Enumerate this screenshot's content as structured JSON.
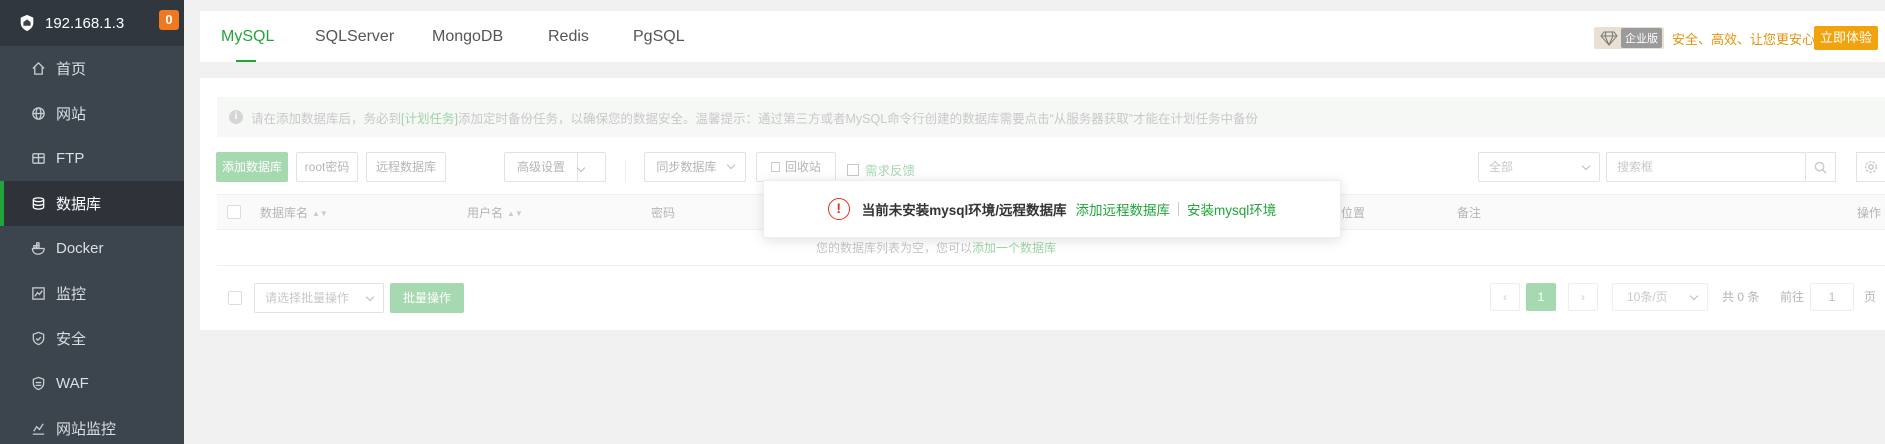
{
  "sidebar": {
    "ip": "192.168.1.3",
    "badge": "0",
    "items": [
      {
        "label": "首页",
        "icon": "home-icon"
      },
      {
        "label": "网站",
        "icon": "globe-icon"
      },
      {
        "label": "FTP",
        "icon": "ftp-icon"
      },
      {
        "label": "数据库",
        "icon": "database-icon"
      },
      {
        "label": "Docker",
        "icon": "docker-icon"
      },
      {
        "label": "监控",
        "icon": "monitor-icon"
      },
      {
        "label": "安全",
        "icon": "shield-icon"
      },
      {
        "label": "WAF",
        "icon": "waf-icon"
      },
      {
        "label": "网站监控",
        "icon": "chart-icon"
      }
    ]
  },
  "tabs": [
    "MySQL",
    "SQLServer",
    "MongoDB",
    "Redis",
    "PgSQL"
  ],
  "enterprise": {
    "tag": "企业版",
    "slogan": "安全、高效、让您更安心",
    "try_button": "立即体验"
  },
  "notice": {
    "text_before": "请在添加数据库后，务必到",
    "link": "[计划任务]",
    "text_after": "添加定时备份任务，以确保您的数据安全。温馨提示：通过第三方或者MySQL命令行创建的数据库需要点击“从服务器获取”才能在计划任务中备份"
  },
  "toolbar": {
    "add_db": "添加数据库",
    "root_pwd": "root密码",
    "remote_db": "远程数据库",
    "advanced": "高级设置",
    "sync_db": "同步数据库",
    "recycle": "回收站",
    "feedback": "需求反馈",
    "filter_all": "全部",
    "search_placeholder": "搜索框"
  },
  "table": {
    "headers": {
      "name": "数据库名",
      "user": "用户名",
      "password": "密码",
      "location": "位置",
      "remark": "备注",
      "ops": "操作"
    },
    "empty_text": "您的数据库列表为空，您可以",
    "empty_link": "添加一个数据库"
  },
  "footer": {
    "batch_select": "请选择批量操作",
    "batch_btn": "批量操作",
    "current_page": "1",
    "per_page": "10条/页",
    "total": "共 0 条",
    "goto_label": "前往",
    "goto_value": "1",
    "page_suffix": "页"
  },
  "alert": {
    "message": "当前未安装mysql环境/远程数据库",
    "link1": "添加远程数据库",
    "link2": "安装mysql环境"
  },
  "colors": {
    "accent": "#20a53a",
    "sidebar_bg": "#3c444d",
    "warning": "#e0321c",
    "enterprise": "#f0a30e"
  }
}
